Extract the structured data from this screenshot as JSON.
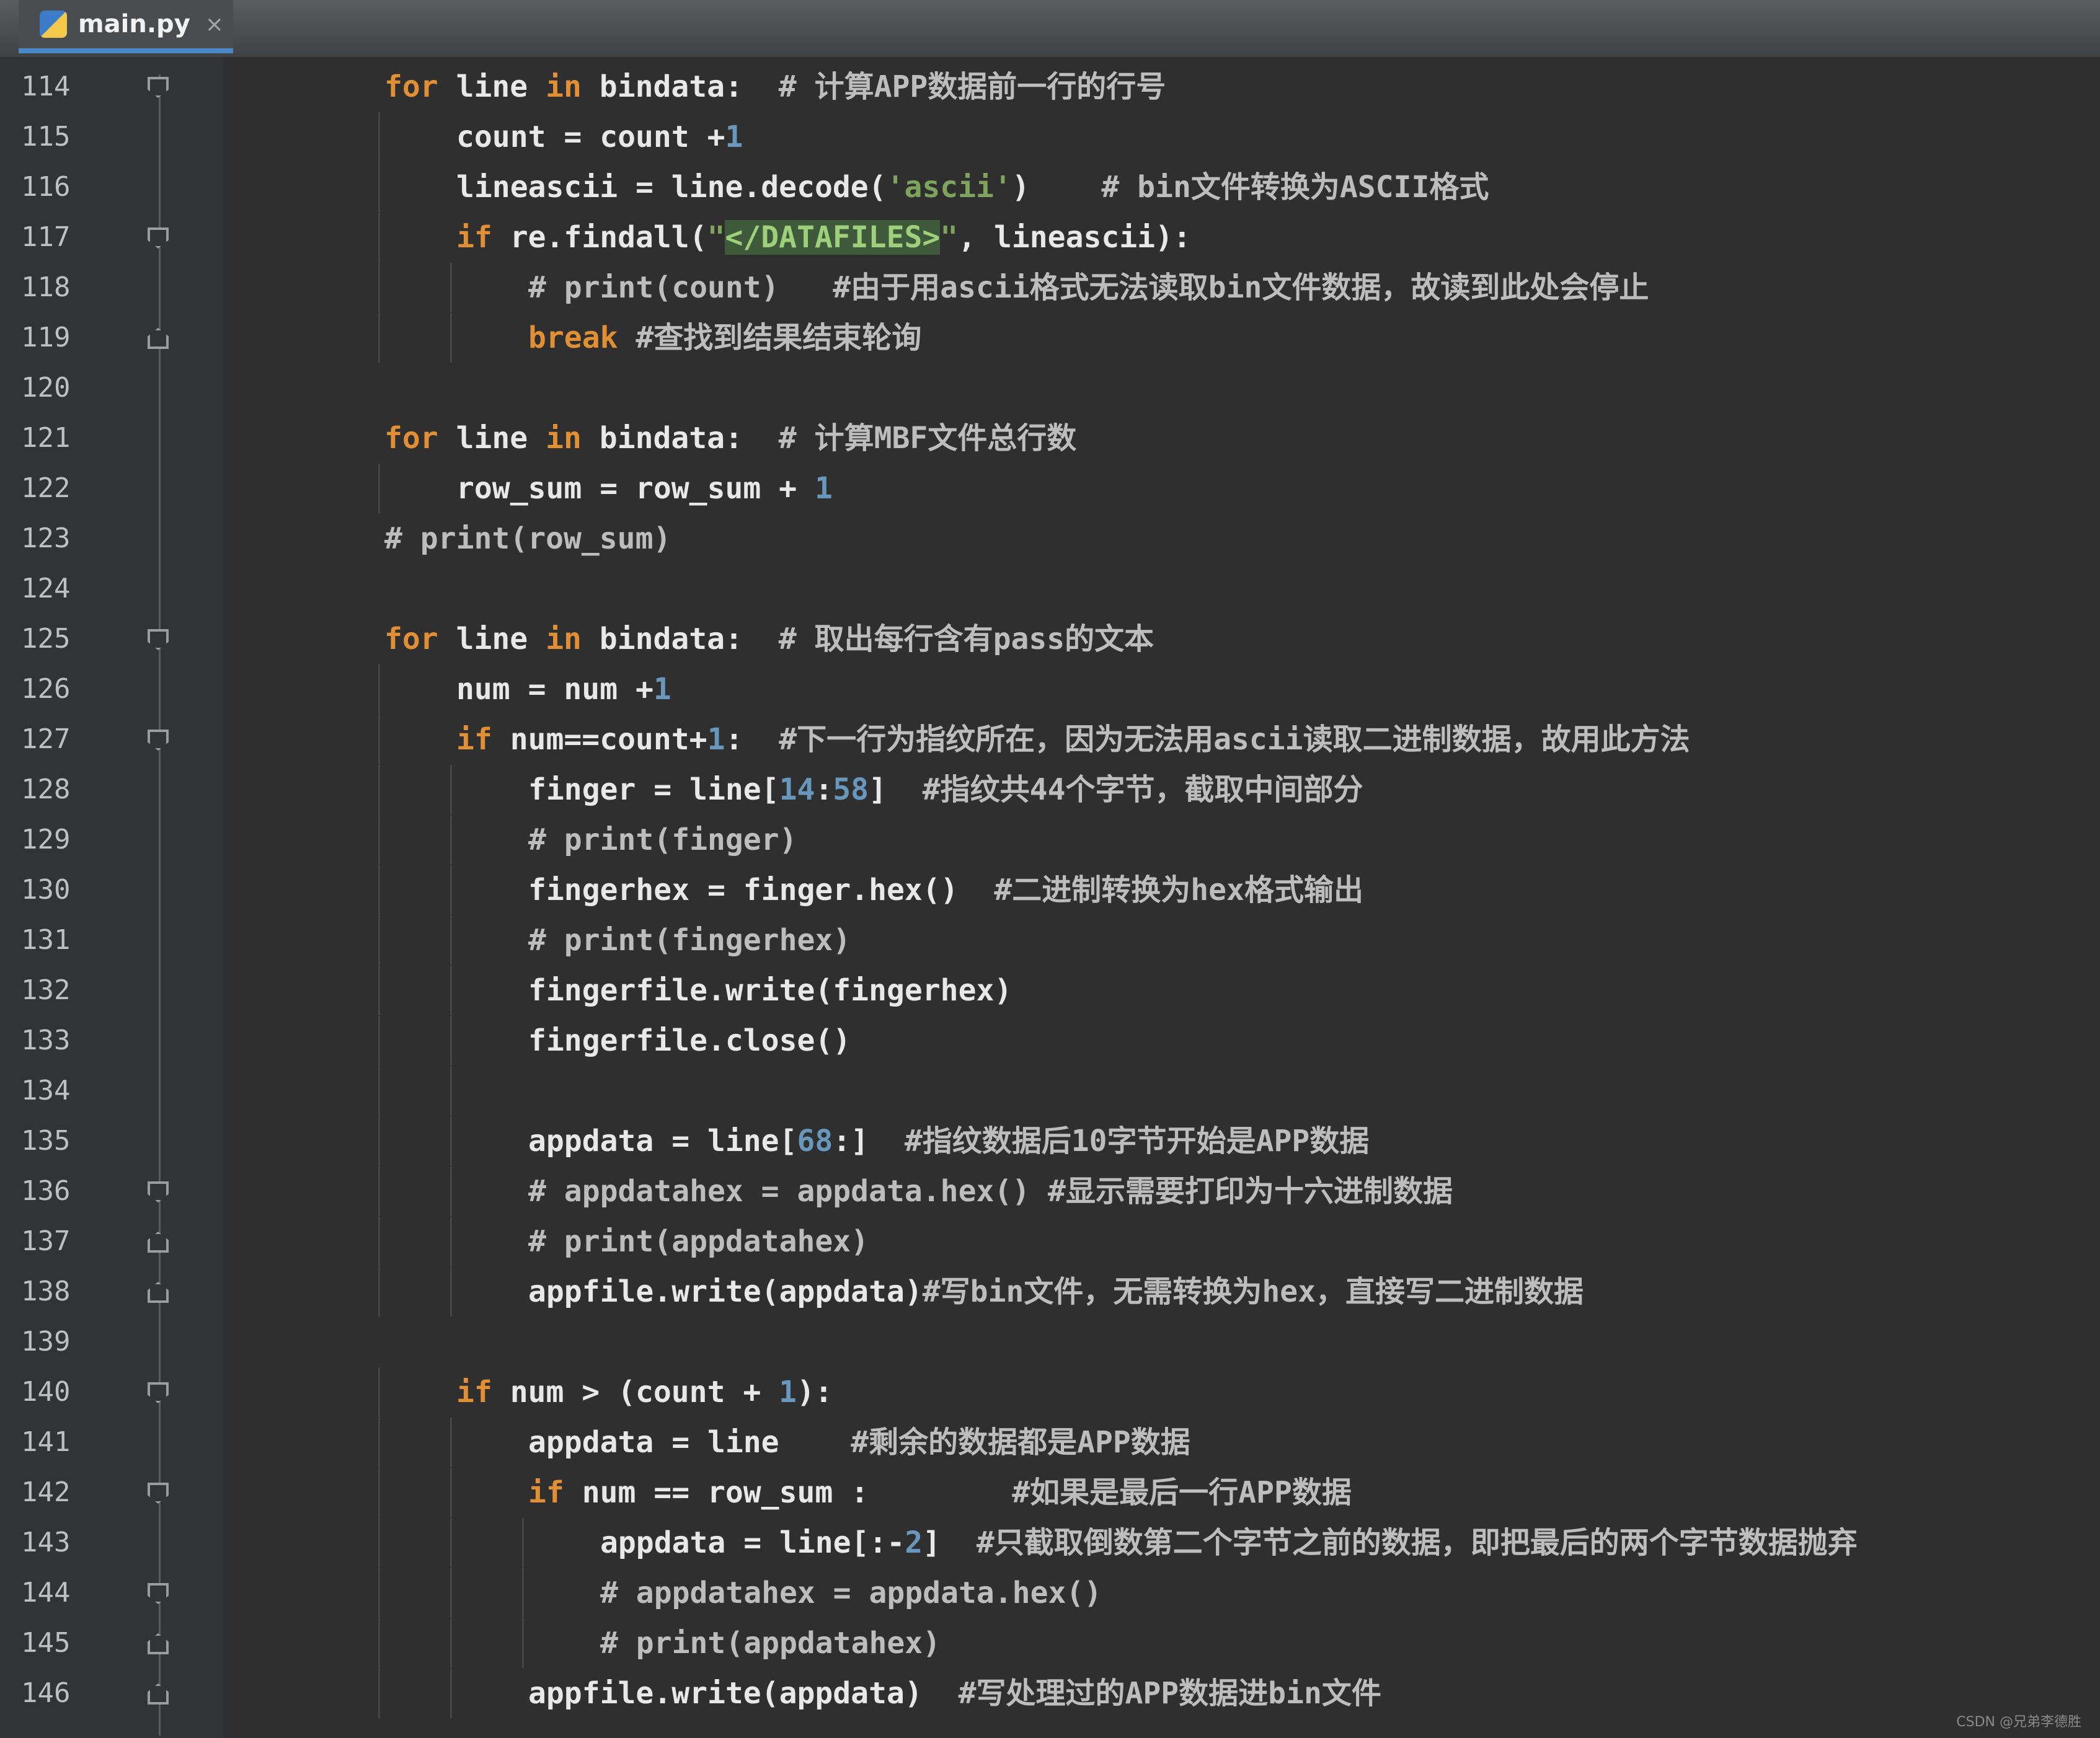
{
  "tab": {
    "filename": "main.py",
    "close": "×"
  },
  "lines": [
    {
      "n": "114",
      "indent": 0,
      "fold": "start",
      "parts": [
        {
          "t": "for",
          "c": "kw"
        },
        {
          "t": " line "
        },
        {
          "t": "in",
          "c": "kw"
        },
        {
          "t": " bindata:  "
        },
        {
          "t": "# 计算APP数据前一行的行号",
          "c": "cm"
        }
      ]
    },
    {
      "n": "115",
      "indent": 1,
      "fold": "",
      "parts": [
        {
          "t": "count = count +"
        },
        {
          "t": "1",
          "c": "num"
        }
      ]
    },
    {
      "n": "116",
      "indent": 1,
      "fold": "",
      "parts": [
        {
          "t": "lineascii = line.decode("
        },
        {
          "t": "'ascii'",
          "c": "str"
        },
        {
          "t": ")    "
        },
        {
          "t": "# bin文件转换为ASCII格式",
          "c": "cm"
        }
      ]
    },
    {
      "n": "117",
      "indent": 1,
      "fold": "start",
      "parts": [
        {
          "t": "if",
          "c": "kw"
        },
        {
          "t": " re.findall("
        },
        {
          "t": "\"",
          "c": "str"
        },
        {
          "t": "</DATAFILES>",
          "c": "hl"
        },
        {
          "t": "\"",
          "c": "str"
        },
        {
          "t": ", lineascii):"
        }
      ]
    },
    {
      "n": "118",
      "indent": 2,
      "fold": "",
      "parts": [
        {
          "t": "# print(count)   #由于用ascii格式无法读取bin文件数据，故读到此处会停止",
          "c": "cm"
        }
      ]
    },
    {
      "n": "119",
      "indent": 2,
      "fold": "end",
      "parts": [
        {
          "t": "break",
          "c": "kw"
        },
        {
          "t": " "
        },
        {
          "t": "#查找到结果结束轮询",
          "c": "cm"
        }
      ]
    },
    {
      "n": "120",
      "indent": 0,
      "fold": "",
      "parts": []
    },
    {
      "n": "121",
      "indent": 0,
      "fold": "",
      "parts": [
        {
          "t": "for",
          "c": "kw"
        },
        {
          "t": " line "
        },
        {
          "t": "in",
          "c": "kw"
        },
        {
          "t": " bindata:  "
        },
        {
          "t": "# 计算MBF文件总行数",
          "c": "cm"
        }
      ]
    },
    {
      "n": "122",
      "indent": 1,
      "fold": "",
      "parts": [
        {
          "t": "row_sum = row_sum + "
        },
        {
          "t": "1",
          "c": "num"
        }
      ]
    },
    {
      "n": "123",
      "indent": 0,
      "fold": "",
      "parts": [
        {
          "t": "# print(row_sum)",
          "c": "cm"
        }
      ]
    },
    {
      "n": "124",
      "indent": 0,
      "fold": "",
      "parts": []
    },
    {
      "n": "125",
      "indent": 0,
      "fold": "start",
      "parts": [
        {
          "t": "for",
          "c": "kw"
        },
        {
          "t": " line "
        },
        {
          "t": "in",
          "c": "kw"
        },
        {
          "t": " bindata:  "
        },
        {
          "t": "# 取出每行含有pass的文本",
          "c": "cm"
        }
      ]
    },
    {
      "n": "126",
      "indent": 1,
      "fold": "",
      "parts": [
        {
          "t": "num = num +"
        },
        {
          "t": "1",
          "c": "num"
        }
      ]
    },
    {
      "n": "127",
      "indent": 1,
      "fold": "start",
      "parts": [
        {
          "t": "if",
          "c": "kw"
        },
        {
          "t": " num==count+"
        },
        {
          "t": "1",
          "c": "num"
        },
        {
          "t": ":  "
        },
        {
          "t": "#下一行为指纹所在，因为无法用ascii读取二进制数据，故用此方法",
          "c": "cm"
        }
      ]
    },
    {
      "n": "128",
      "indent": 2,
      "fold": "",
      "parts": [
        {
          "t": "finger = line["
        },
        {
          "t": "14",
          "c": "num"
        },
        {
          "t": ":"
        },
        {
          "t": "58",
          "c": "num"
        },
        {
          "t": "]  "
        },
        {
          "t": "#指纹共44个字节，截取中间部分",
          "c": "cm"
        }
      ]
    },
    {
      "n": "129",
      "indent": 2,
      "fold": "",
      "parts": [
        {
          "t": "# print(finger)",
          "c": "cm"
        }
      ]
    },
    {
      "n": "130",
      "indent": 2,
      "fold": "",
      "parts": [
        {
          "t": "fingerhex = finger.hex()  "
        },
        {
          "t": "#二进制转换为hex格式输出",
          "c": "cm"
        }
      ]
    },
    {
      "n": "131",
      "indent": 2,
      "fold": "",
      "parts": [
        {
          "t": "# print(fingerhex)",
          "c": "cm"
        }
      ]
    },
    {
      "n": "132",
      "indent": 2,
      "fold": "",
      "parts": [
        {
          "t": "fingerfile.write(fingerhex)"
        }
      ]
    },
    {
      "n": "133",
      "indent": 2,
      "fold": "",
      "parts": [
        {
          "t": "fingerfile.close()"
        }
      ]
    },
    {
      "n": "134",
      "indent": 2,
      "fold": "",
      "parts": []
    },
    {
      "n": "135",
      "indent": 2,
      "fold": "",
      "parts": [
        {
          "t": "appdata = line["
        },
        {
          "t": "68",
          "c": "num"
        },
        {
          "t": ":]  "
        },
        {
          "t": "#指纹数据后10字节开始是APP数据",
          "c": "cm"
        }
      ]
    },
    {
      "n": "136",
      "indent": 2,
      "fold": "start",
      "parts": [
        {
          "t": "# appdatahex = appdata.hex() #显示需要打印为十六进制数据",
          "c": "cm"
        }
      ]
    },
    {
      "n": "137",
      "indent": 2,
      "fold": "end",
      "parts": [
        {
          "t": "# print(appdatahex)",
          "c": "cm"
        }
      ]
    },
    {
      "n": "138",
      "indent": 2,
      "fold": "end",
      "parts": [
        {
          "t": "appfile.write(appdata)"
        },
        {
          "t": "#写bin文件，无需转换为hex，直接写二进制数据",
          "c": "cm"
        }
      ]
    },
    {
      "n": "139",
      "indent": 0,
      "fold": "",
      "parts": []
    },
    {
      "n": "140",
      "indent": 1,
      "fold": "start",
      "parts": [
        {
          "t": "if",
          "c": "kw"
        },
        {
          "t": " num > (count + "
        },
        {
          "t": "1",
          "c": "num"
        },
        {
          "t": "):"
        }
      ]
    },
    {
      "n": "141",
      "indent": 2,
      "fold": "",
      "parts": [
        {
          "t": "appdata = line    "
        },
        {
          "t": "#剩余的数据都是APP数据",
          "c": "cm"
        }
      ]
    },
    {
      "n": "142",
      "indent": 2,
      "fold": "start",
      "parts": [
        {
          "t": "if",
          "c": "kw"
        },
        {
          "t": " num == row_sum :        "
        },
        {
          "t": "#如果是最后一行APP数据",
          "c": "cm"
        }
      ]
    },
    {
      "n": "143",
      "indent": 3,
      "fold": "",
      "parts": [
        {
          "t": "appdata = line[:-"
        },
        {
          "t": "2",
          "c": "num"
        },
        {
          "t": "]  "
        },
        {
          "t": "#只截取倒数第二个字节之前的数据，即把最后的两个字节数据抛弃",
          "c": "cm"
        }
      ]
    },
    {
      "n": "144",
      "indent": 3,
      "fold": "start",
      "parts": [
        {
          "t": "# appdatahex = appdata.hex()",
          "c": "cm"
        }
      ]
    },
    {
      "n": "145",
      "indent": 3,
      "fold": "end",
      "parts": [
        {
          "t": "# print(appdatahex)",
          "c": "cm"
        }
      ]
    },
    {
      "n": "146",
      "indent": 2,
      "fold": "end",
      "parts": [
        {
          "t": "appfile.write(appdata)  "
        },
        {
          "t": "#写处理过的APP数据进bin文件",
          "c": "cm"
        }
      ]
    }
  ],
  "watermark": "CSDN @兄弟李德胜"
}
